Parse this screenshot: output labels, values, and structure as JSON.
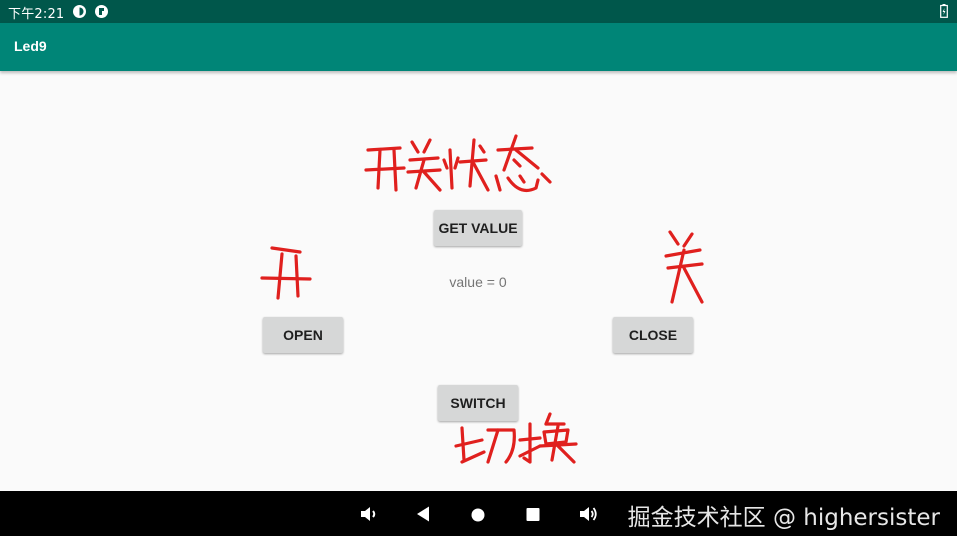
{
  "status_bar": {
    "time": "下午2:21",
    "left_icons": [
      "notification-app-icon",
      "notification-app-icon"
    ],
    "battery": "battery-icon",
    "background": "#00574b"
  },
  "app_bar": {
    "title": "Led9",
    "background": "#008577"
  },
  "main": {
    "get_value_label": "GET VALUE",
    "value_text": "value = 0",
    "open_label": "OPEN",
    "close_label": "CLOSE",
    "switch_label": "SWITCH"
  },
  "annotations": {
    "color": "#e0201e",
    "items": [
      "开关状态",
      "开",
      "关",
      "切换"
    ]
  },
  "nav_bar": {
    "icons": [
      "volume-down-icon",
      "back-icon",
      "home-icon",
      "recents-icon",
      "volume-up-icon"
    ]
  },
  "watermark": "掘金技术社区 @ highersister"
}
